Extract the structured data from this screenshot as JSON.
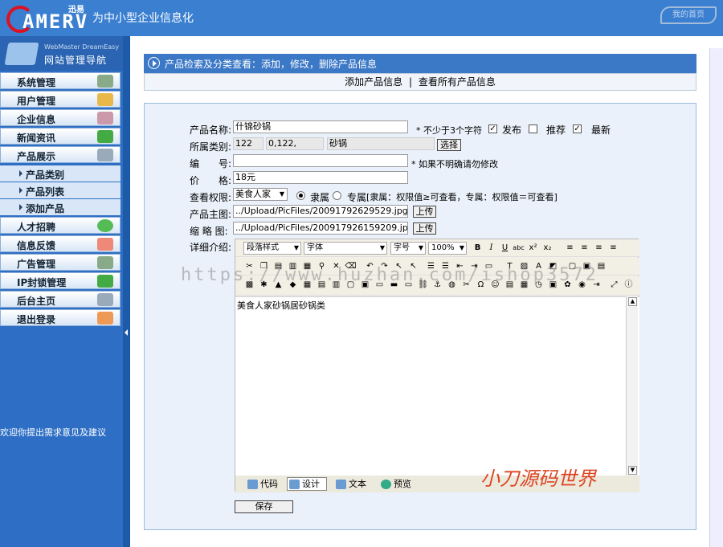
{
  "header": {
    "logo_text": "AMERV",
    "logo_small": "迅易",
    "slogan": "为中小型企业信息化",
    "home_link": "我的首页"
  },
  "nav": {
    "sub": "WebMaster DreamEasy",
    "title": "网站管理导航",
    "items": [
      {
        "label": "系统管理"
      },
      {
        "label": "用户管理"
      },
      {
        "label": "企业信息"
      },
      {
        "label": "新闻资讯"
      },
      {
        "label": "产品展示"
      }
    ],
    "sub_items": [
      {
        "label": "产品类别"
      },
      {
        "label": "产品列表"
      },
      {
        "label": "添加产品"
      }
    ],
    "items2": [
      {
        "label": "人才招聘"
      },
      {
        "label": "信息反馈"
      },
      {
        "label": "广告管理"
      },
      {
        "label": "IP封锁管理"
      },
      {
        "label": "后台主页"
      },
      {
        "label": "退出登录"
      }
    ],
    "feedback": "欢迎你提出需求意见及建议"
  },
  "page": {
    "title": "产品检索及分类查看：添加，修改，删除产品信息",
    "link_add": "添加产品信息",
    "separator": "|",
    "link_view": "查看所有产品信息"
  },
  "form": {
    "name_label": "产品名称:",
    "name_value": "什锦砂锅",
    "name_hint": "* 不少于3个字符",
    "publish": "发布",
    "recommend": "推荐",
    "latest": "最新",
    "category_label": "所属类别:",
    "cat_id": "122",
    "cat_path": "0,122,",
    "cat_name": "砂锅",
    "select_btn": "选择",
    "code_label": "编　　号:",
    "code_value": "",
    "code_hint": "* 如果不明确请勿修改",
    "price_label": "价　　格:",
    "price_value": "18元",
    "perm_label": "查看权限:",
    "perm_value": "美食人家",
    "perm_opt1": "隶属",
    "perm_opt2": "专属",
    "perm_hint": "[隶属：权限值≥可查看，专属：权限值＝可查看]",
    "img_label": "产品主图:",
    "img_value": "../Upload/PicFiles/20091792629529.jpg",
    "upload": "上传",
    "thumb_label": "缩 略 图:",
    "thumb_value": "../Upload/PicFiles/200917926159209.jpg",
    "detail_label": "详细介绍:",
    "editor": {
      "style": "段落样式",
      "font": "字体",
      "size": "字号",
      "zoom": "100%",
      "content": "美食人家砂锅居砂锅类",
      "modes": [
        {
          "label": "代码"
        },
        {
          "label": "设计"
        },
        {
          "label": "文本"
        },
        {
          "label": "预览"
        }
      ]
    },
    "save": "保存"
  },
  "watermark": {
    "red": "小刀源码世界",
    "url": "https://www.huzhan.com/ishop3572"
  }
}
